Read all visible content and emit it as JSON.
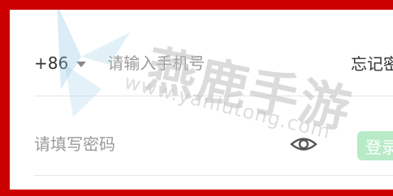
{
  "login": {
    "country_code": "+86",
    "phone_placeholder": "请输入手机号",
    "forgot_label": "忘记密码",
    "password_placeholder": "请填写密码",
    "login_label": "登录"
  },
  "watermark": {
    "brand": "燕鹿手游",
    "url": "www.yanlutong.com"
  },
  "colors": {
    "frame": "#cc0000",
    "login_button": "#b7ebc7",
    "divider": "#e6e6e6"
  },
  "icons": {
    "country_dropdown": "caret-down-icon",
    "password_visibility": "eye-icon"
  }
}
